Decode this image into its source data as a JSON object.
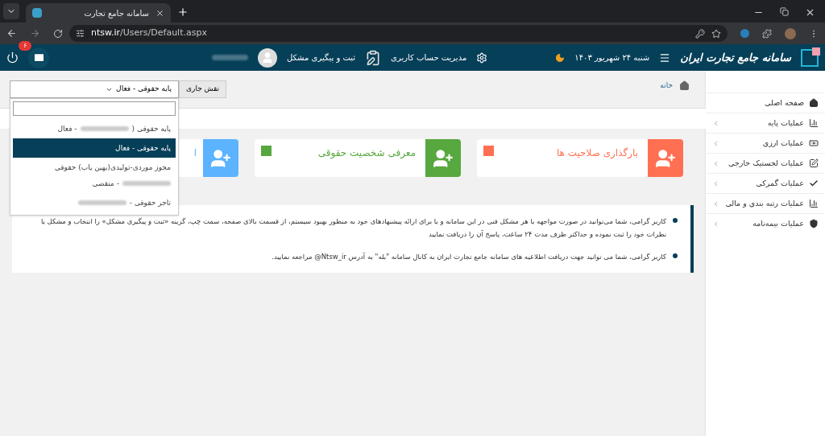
{
  "browser": {
    "tab_title": "سامانه جامع تجارت",
    "url_host": "ntsw.ir",
    "url_path": "/Users/Default.aspx"
  },
  "header": {
    "site_title": "سامانه جامع تجارت ایران",
    "date": "شنبه ۲۴ شهریور ۱۴۰۳",
    "account_link": "مدیریت حساب کاربری",
    "issue_link": "ثبت و پیگیری مشکل",
    "user_name_redacted": true,
    "mail_count": "۶"
  },
  "breadcrumb": "خانه",
  "role": {
    "label": "نقش جاری",
    "value": "پایه حقوقی - فعال",
    "expanded": true,
    "options": [
      {
        "parts": [
          "پایه حقوقی (",
          "- فعال"
        ],
        "redacted": true,
        "selected": false
      },
      {
        "parts": [
          "پایه حقوقی - فعال"
        ],
        "redacted": false,
        "selected": true
      },
      {
        "parts": [
          "مجوز موردی-تولیدی(بهین یاب) حقوقی",
          "- منقضی"
        ],
        "redacted": true,
        "selected": false
      },
      {
        "parts": [
          "تاجر حقوقی -"
        ],
        "redacted": true,
        "selected": false
      }
    ]
  },
  "cards": [
    {
      "title": "بارگذاری صلاحیت ها",
      "color": "#ff7052",
      "square": true
    },
    {
      "title": "معرفی شخصیت حقوقی",
      "color": "#57a83f",
      "square": true
    },
    {
      "title": "ا",
      "color": "#5cb3ff",
      "square": false
    }
  ],
  "notices": [
    "کاربر گرامی، شما می‌توانید در صورت مواجهه با هر مشکل فنی در این سامانه و یا برای ارائه پیشنهادهای خود به منظور بهبود سیستم، از قسمت بالای صفحه، سمت چپ، گزینه «ثبت و پیگیری مشکل» را انتخاب و مشکل یا نظرات خود را ثبت نموده و حداکثر ظرف مدت ۲۴ ساعت، پاسخ آن را دریافت نمایید",
    "کاربر گرامی، شما می توانید جهت دریافت اطلاعیه های سامانه جامع تجارت ایران به کانال سامانه \"بله\" به آدرس Ntsw_ir@ مراجعه نمایید."
  ],
  "sidebar": [
    {
      "label": "صفحه اصلی",
      "kind": "home",
      "has_children": false
    },
    {
      "label": "عملیات پایه",
      "kind": "chart",
      "has_children": true
    },
    {
      "label": "عملیات ارزی",
      "kind": "money",
      "has_children": true
    },
    {
      "label": "عملیات لجستیک خارجی",
      "kind": "edit",
      "has_children": true
    },
    {
      "label": "عملیات گمرکی",
      "kind": "check",
      "has_children": true
    },
    {
      "label": "عملیات رتبه بندی و مالی",
      "kind": "chart",
      "has_children": true
    },
    {
      "label": "عملیات بیمه‌نامه",
      "kind": "shield",
      "has_children": true
    }
  ]
}
